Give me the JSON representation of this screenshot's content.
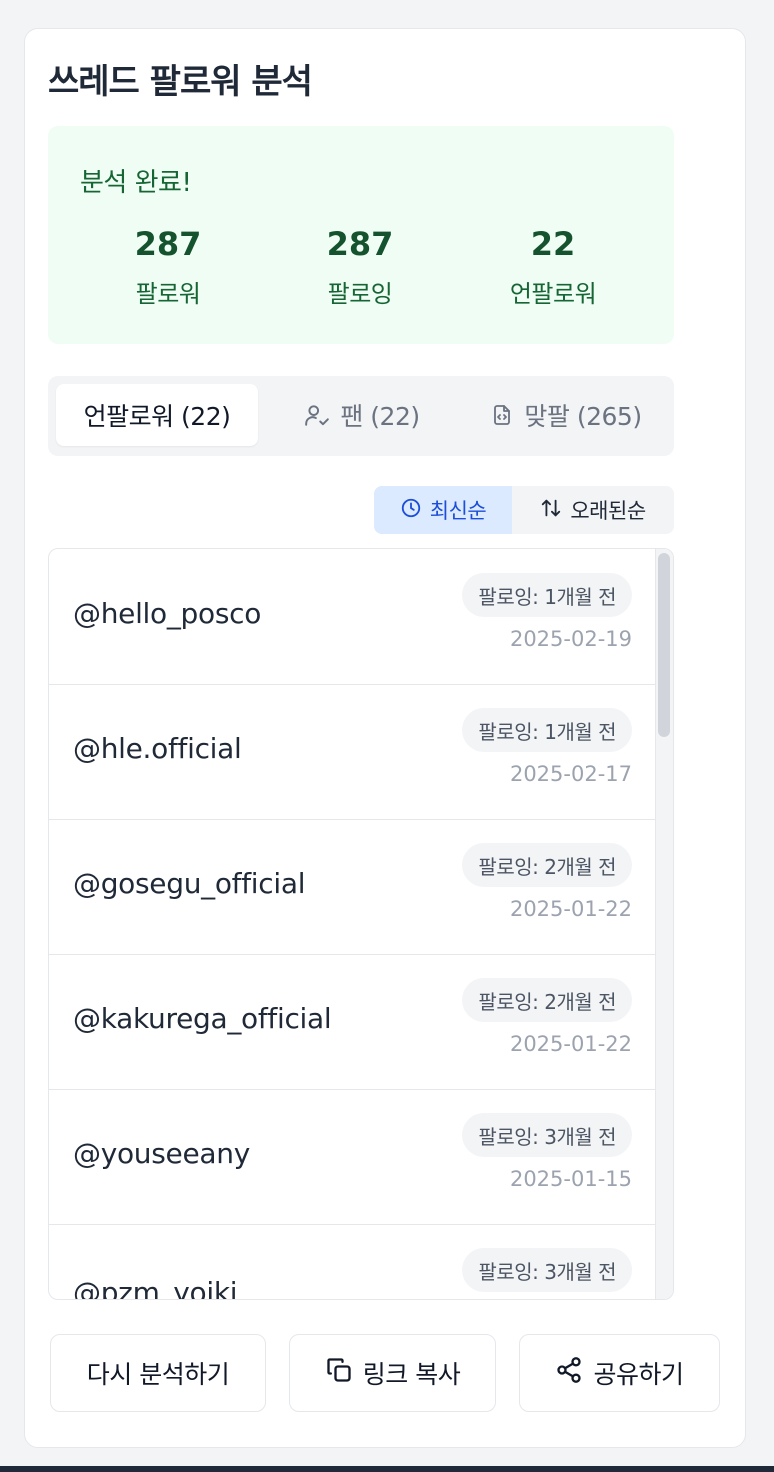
{
  "page": {
    "title": "쓰레드 팔로워 분석"
  },
  "summary": {
    "heading": "분석 완료!",
    "stats": [
      {
        "value": "287",
        "label": "팔로워"
      },
      {
        "value": "287",
        "label": "팔로잉"
      },
      {
        "value": "22",
        "label": "언팔로워"
      }
    ]
  },
  "tabs": [
    {
      "label": "언팔로워 (22)",
      "icon": "none",
      "active": true
    },
    {
      "label": "팬 (22)",
      "icon": "user-check-icon",
      "active": false
    },
    {
      "label": "맞팔 (265)",
      "icon": "file-code-icon",
      "active": false
    }
  ],
  "sort": {
    "newest": {
      "label": "최신순",
      "icon": "clock-icon",
      "active": true
    },
    "oldest": {
      "label": "오래된순",
      "icon": "sort-arrows-icon",
      "active": false
    }
  },
  "users": [
    {
      "handle": "@hello_posco",
      "badge": "팔로잉: 1개월 전",
      "date": "2025-02-19"
    },
    {
      "handle": "@hle.official",
      "badge": "팔로잉: 1개월 전",
      "date": "2025-02-17"
    },
    {
      "handle": "@gosegu_official",
      "badge": "팔로잉: 2개월 전",
      "date": "2025-01-22"
    },
    {
      "handle": "@kakurega_official",
      "badge": "팔로잉: 2개월 전",
      "date": "2025-01-22"
    },
    {
      "handle": "@youseeany",
      "badge": "팔로잉: 3개월 전",
      "date": "2025-01-15"
    },
    {
      "handle": "@pzm_yoiki",
      "badge": "팔로잉: 3개월 전",
      "date": ""
    }
  ],
  "actions": {
    "reanalyze": "다시 분석하기",
    "copy_link": "링크 복사",
    "share": "공유하기"
  },
  "colors": {
    "accent_green_bg": "#f0fdf4",
    "accent_green_text": "#166534",
    "accent_blue_bg": "#dbeafe",
    "accent_blue_text": "#1d4ed8"
  }
}
